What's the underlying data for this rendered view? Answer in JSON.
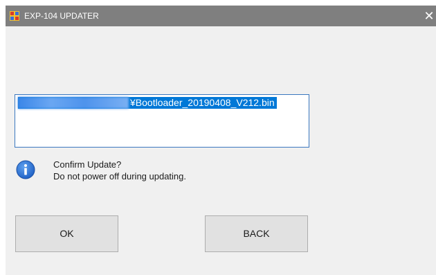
{
  "window": {
    "title": "EXP-104 UPDATER",
    "close_glyph": "✕",
    "titlebar_color": "#7f7f7f",
    "background_color": "#f0f0f0"
  },
  "path_box": {
    "file_path": "¥Bootloader_20190408_V212.bin",
    "selection_color": "#0078d7"
  },
  "message": {
    "icon": "info-icon",
    "line1": "Confirm Update?",
    "line2": "Do not power off during updating."
  },
  "buttons": {
    "ok_label": "OK",
    "back_label": "BACK"
  }
}
